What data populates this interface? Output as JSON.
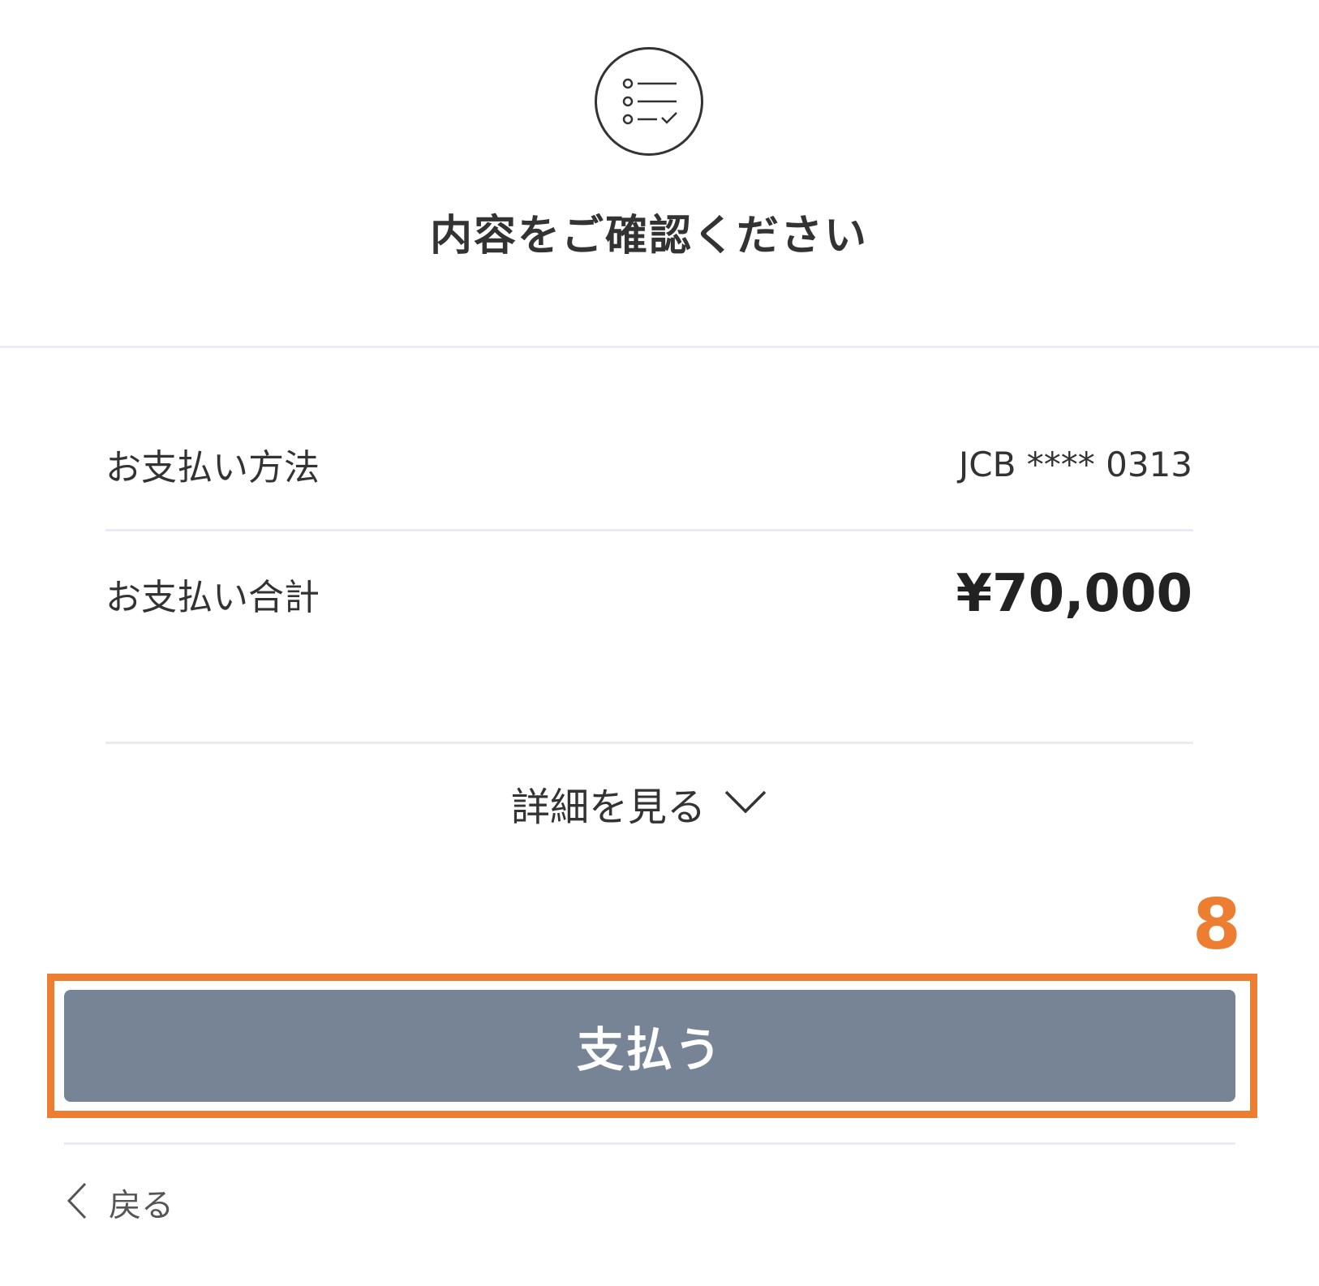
{
  "header": {
    "icon": "checklist-icon",
    "title": "内容をご確認ください"
  },
  "summary": {
    "payment_method": {
      "label": "お支払い方法",
      "value": "JCB **** 0313"
    },
    "payment_total": {
      "label": "お支払い合計",
      "value": "¥70,000"
    }
  },
  "details_toggle": {
    "label": "詳細を見る",
    "icon": "chevron-down-icon"
  },
  "annotation": {
    "step_number": "8",
    "color": "#ed7d31"
  },
  "pay_button": {
    "label": "支払う",
    "color": "#778496"
  },
  "back_link": {
    "label": "戻る",
    "icon": "chevron-left-icon"
  }
}
